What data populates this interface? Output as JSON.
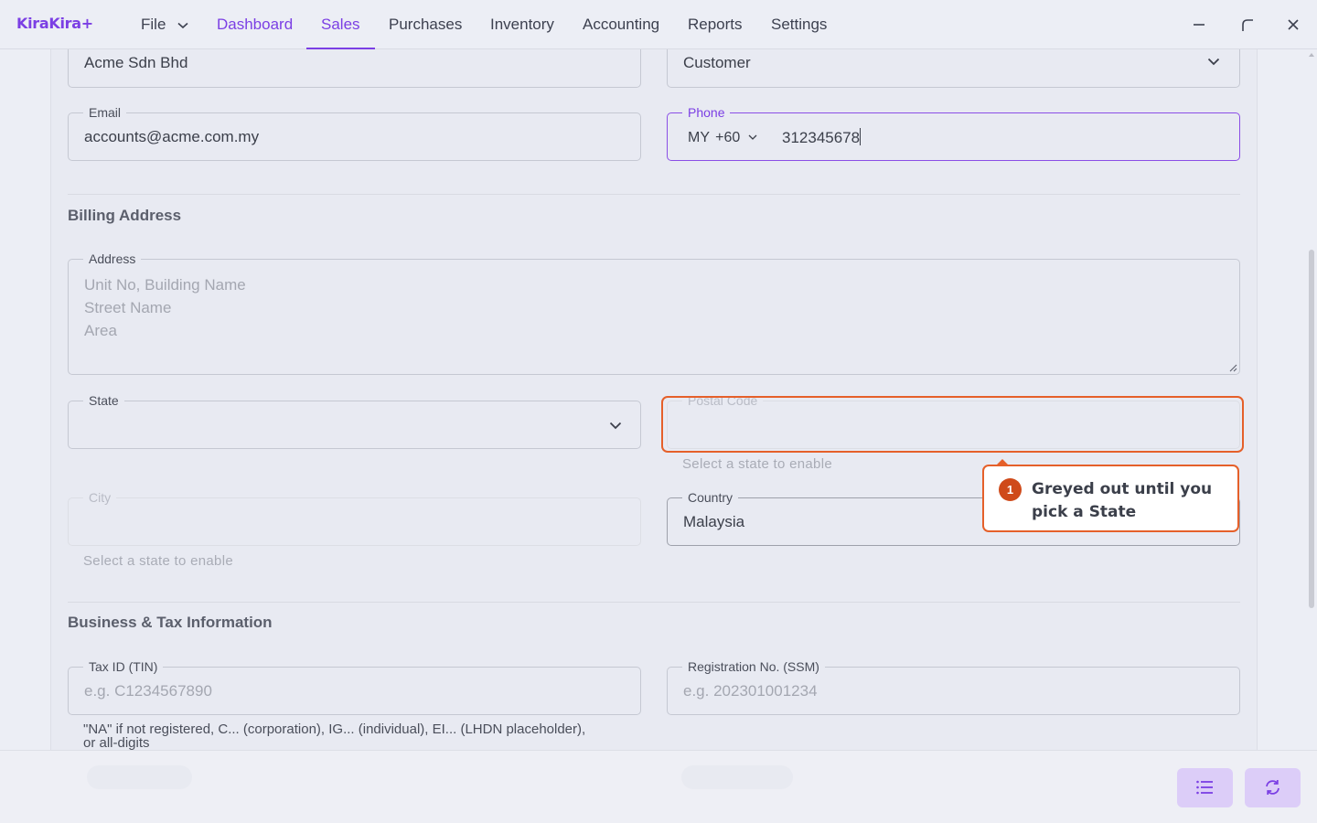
{
  "app": {
    "name": "KiraKira+"
  },
  "nav": {
    "file": "File",
    "dashboard": "Dashboard",
    "sales": "Sales",
    "purchases": "Purchases",
    "inventory": "Inventory",
    "accounting": "Accounting",
    "reports": "Reports",
    "settings": "Settings"
  },
  "form": {
    "company_name": "Acme Sdn Bhd",
    "contact_type": "Customer",
    "email": {
      "label": "Email",
      "value": "accounts@acme.com.my"
    },
    "phone": {
      "label": "Phone",
      "country": "MY",
      "code": "+60",
      "value": "312345678"
    },
    "billing": {
      "title": "Billing Address",
      "address_label": "Address",
      "address_placeholder": [
        "Unit No, Building Name",
        "Street Name",
        "Area"
      ],
      "state_label": "State",
      "postal_label": "Postal Code",
      "postal_helper": "Select a state to enable",
      "city_label": "City",
      "city_helper": "Select a state to enable",
      "country_label": "Country",
      "country_value": "Malaysia"
    },
    "business": {
      "title": "Business & Tax Information",
      "tin_label": "Tax ID (TIN)",
      "tin_placeholder": "e.g. C1234567890",
      "tin_helper_1": "\"NA\" if not registered, C... (corporation), IG... (individual), EI... (LHDN placeholder),",
      "tin_helper_2": "or all-digits",
      "ssm_label": "Registration No. (SSM)",
      "ssm_placeholder": "e.g. 202301001234"
    }
  },
  "tooltip": {
    "step": "1",
    "text": "Greyed out until you pick a State"
  },
  "colors": {
    "accent": "#7b3fe4",
    "highlight": "#e5602a"
  }
}
